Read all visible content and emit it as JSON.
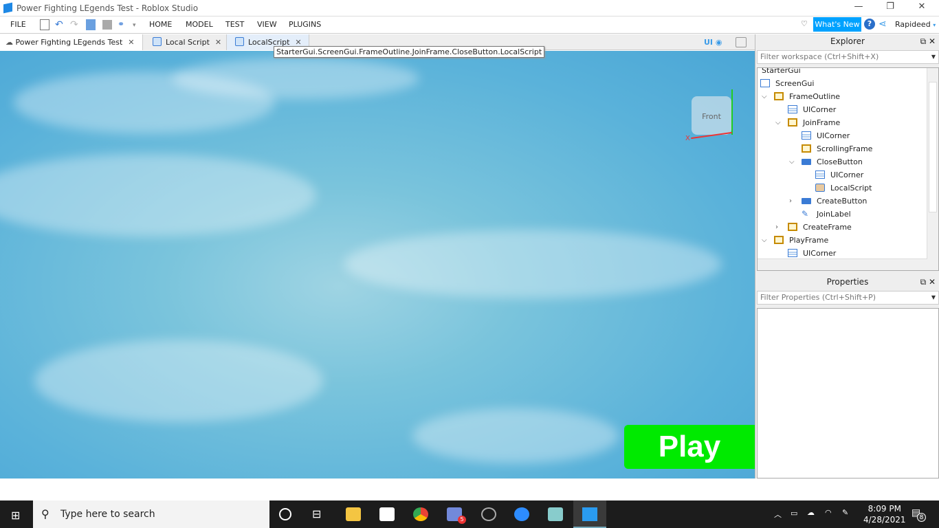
{
  "window": {
    "title": "Power Fighting LEgends Test - Roblox Studio",
    "min": "—",
    "max": "❐",
    "close": "✕"
  },
  "menu": {
    "file": "FILE",
    "home": "HOME",
    "model": "MODEL",
    "test": "TEST",
    "view": "VIEW",
    "plugins": "PLUGINS",
    "whats_new": "What's New",
    "user": "Rapideed"
  },
  "tabs": [
    {
      "label": "Power Fighting LEgends Test"
    },
    {
      "label": "Local Script"
    },
    {
      "label": "LocalScript"
    }
  ],
  "tooltip": "StarterGui.ScreenGui.FrameOutline.JoinFrame.CloseButton.LocalScript",
  "viewport": {
    "ui_toggle": "UI",
    "gizmo_label": "Front",
    "axis_x": "X",
    "play_button": "Play"
  },
  "explorer": {
    "title": "Explorer",
    "filter_placeholder": "Filter workspace (Ctrl+Shift+X)",
    "items": [
      {
        "label": "StarterGui"
      },
      {
        "label": "ScreenGui"
      },
      {
        "label": "FrameOutline"
      },
      {
        "label": "UICorner"
      },
      {
        "label": "JoinFrame"
      },
      {
        "label": "UICorner"
      },
      {
        "label": "ScrollingFrame"
      },
      {
        "label": "CloseButton"
      },
      {
        "label": "UICorner"
      },
      {
        "label": "LocalScript"
      },
      {
        "label": "CreateButton"
      },
      {
        "label": "JoinLabel"
      },
      {
        "label": "CreateFrame"
      },
      {
        "label": "PlayFrame"
      },
      {
        "label": "UICorner"
      }
    ]
  },
  "properties": {
    "title": "Properties",
    "filter_placeholder": "Filter Properties (Ctrl+Shift+P)"
  },
  "taskbar": {
    "search_placeholder": "Type here to search",
    "time": "8:09 PM",
    "date": "4/28/2021",
    "notifications": "8",
    "badge": "5"
  }
}
